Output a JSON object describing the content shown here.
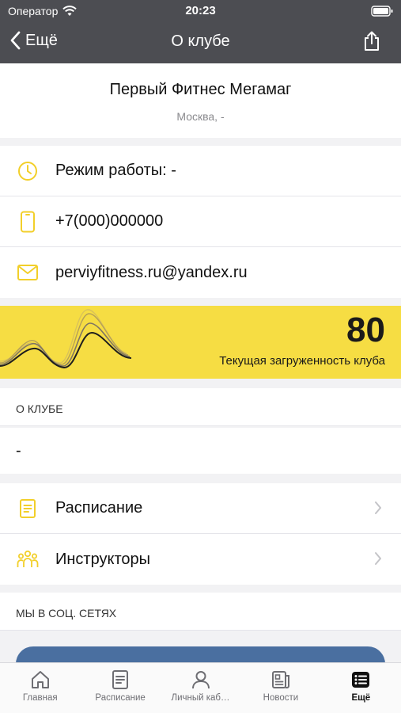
{
  "status": {
    "carrier": "Оператор",
    "time": "20:23"
  },
  "nav": {
    "back_label": "Ещё",
    "title": "О клубе"
  },
  "club": {
    "name": "Первый Фитнес Мегамаг",
    "city": "Москва, -"
  },
  "info": {
    "hours": "Режим работы: -",
    "phone": "+7(000)000000",
    "email": "perviyfitness.ru@yandex.ru"
  },
  "load": {
    "value": "80",
    "caption": "Текущая загруженность клуба"
  },
  "about": {
    "header": "О КЛУБЕ",
    "text": "-"
  },
  "links": {
    "schedule": "Расписание",
    "instructors": "Инструкторы"
  },
  "social": {
    "header": "МЫ В СОЦ. СЕТЯХ"
  },
  "tabs": [
    {
      "label": "Главная",
      "icon": "home-icon"
    },
    {
      "label": "Расписание",
      "icon": "schedule-icon"
    },
    {
      "label": "Личный каб…",
      "icon": "profile-icon"
    },
    {
      "label": "Новости",
      "icon": "news-icon"
    },
    {
      "label": "Ещё",
      "icon": "more-icon",
      "active": true
    }
  ],
  "colors": {
    "accent": "#f6dd43",
    "bar": "#4c4d52",
    "vk": "#4a6fa0"
  }
}
